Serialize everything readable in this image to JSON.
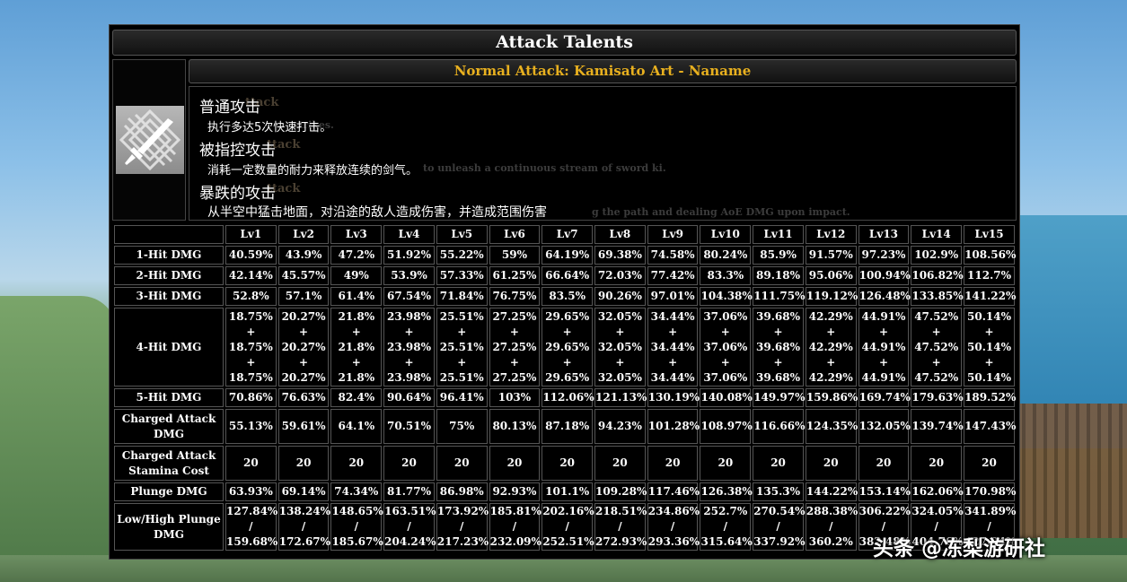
{
  "panel": {
    "title": "Attack Talents",
    "talent_name": "Normal Attack: Kamisato Art - Naname",
    "icon": "sword-talent-icon"
  },
  "description": {
    "sections": [
      {
        "heading": "普通攻击",
        "text": "执行多达5次快速打击。"
      },
      {
        "heading": "被指控攻击",
        "text": "消耗一定数量的耐力来释放连续的剑气。"
      },
      {
        "heading": "暴跌的攻击",
        "text": "从半空中猛击地面，对沿途的敌人造成伤害，并造成范围伤害"
      }
    ],
    "ghost_text": [
      "ttack",
      "strikes.",
      "ttack",
      "to unleash a continuous stream of sword ki.",
      "ttack",
      "g the path and dealing AoE DMG upon impact."
    ]
  },
  "table": {
    "levels": [
      "Lv1",
      "Lv2",
      "Lv3",
      "Lv4",
      "Lv5",
      "Lv6",
      "Lv7",
      "Lv8",
      "Lv9",
      "Lv10",
      "Lv11",
      "Lv12",
      "Lv13",
      "Lv14",
      "Lv15"
    ],
    "hit1": {
      "label": "1-Hit DMG",
      "values": [
        "40.59%",
        "43.9%",
        "47.2%",
        "51.92%",
        "55.22%",
        "59%",
        "64.19%",
        "69.38%",
        "74.58%",
        "80.24%",
        "85.9%",
        "91.57%",
        "97.23%",
        "102.9%",
        "108.56%"
      ]
    },
    "hit2": {
      "label": "2-Hit DMG",
      "values": [
        "42.14%",
        "45.57%",
        "49%",
        "53.9%",
        "57.33%",
        "61.25%",
        "66.64%",
        "72.03%",
        "77.42%",
        "83.3%",
        "89.18%",
        "95.06%",
        "100.94%",
        "106.82%",
        "112.7%"
      ]
    },
    "hit3": {
      "label": "3-Hit DMG",
      "values": [
        "52.8%",
        "57.1%",
        "61.4%",
        "67.54%",
        "71.84%",
        "76.75%",
        "83.5%",
        "90.26%",
        "97.01%",
        "104.38%",
        "111.75%",
        "119.12%",
        "126.48%",
        "133.85%",
        "141.22%"
      ]
    },
    "hit4": {
      "label": "4-Hit DMG",
      "values": [
        "18.75%",
        "20.27%",
        "21.8%",
        "23.98%",
        "25.51%",
        "27.25%",
        "29.65%",
        "32.05%",
        "34.44%",
        "37.06%",
        "39.68%",
        "42.29%",
        "44.91%",
        "47.52%",
        "50.14%"
      ],
      "joiner": "+"
    },
    "hit5": {
      "label": "5-Hit DMG",
      "values": [
        "70.86%",
        "76.63%",
        "82.4%",
        "90.64%",
        "96.41%",
        "103%",
        "112.06%",
        "121.13%",
        "130.19%",
        "140.08%",
        "149.97%",
        "159.86%",
        "169.74%",
        "179.63%",
        "189.52%"
      ]
    },
    "charged": {
      "label": "Charged Attack DMG",
      "values": [
        "55.13%",
        "59.61%",
        "64.1%",
        "70.51%",
        "75%",
        "80.13%",
        "87.18%",
        "94.23%",
        "101.28%",
        "108.97%",
        "116.66%",
        "124.35%",
        "132.05%",
        "139.74%",
        "147.43%"
      ]
    },
    "stamina": {
      "label": "Charged Attack Stamina Cost",
      "values": [
        "20",
        "20",
        "20",
        "20",
        "20",
        "20",
        "20",
        "20",
        "20",
        "20",
        "20",
        "20",
        "20",
        "20",
        "20"
      ]
    },
    "plunge": {
      "label": "Plunge DMG",
      "values": [
        "63.93%",
        "69.14%",
        "74.34%",
        "81.77%",
        "86.98%",
        "92.93%",
        "101.1%",
        "109.28%",
        "117.46%",
        "126.38%",
        "135.3%",
        "144.22%",
        "153.14%",
        "162.06%",
        "170.98%"
      ]
    },
    "lowhigh": {
      "label": "Low/High Plunge DMG",
      "low": [
        "127.84%",
        "138.24%",
        "148.65%",
        "163.51%",
        "173.92%",
        "185.81%",
        "202.16%",
        "218.51%",
        "234.86%",
        "252.7%",
        "270.54%",
        "288.38%",
        "306.22%",
        "324.05%",
        "341.89%"
      ],
      "high": [
        "159.68%",
        "172.67%",
        "185.67%",
        "204.24%",
        "217.23%",
        "232.09%",
        "252.51%",
        "272.93%",
        "293.36%",
        "315.64%",
        "337.92%",
        "360.2%",
        "382.48%",
        "404.76%",
        "427.04%"
      ],
      "joiner": "/"
    }
  },
  "watermark": "头条 @冻梨游研社"
}
